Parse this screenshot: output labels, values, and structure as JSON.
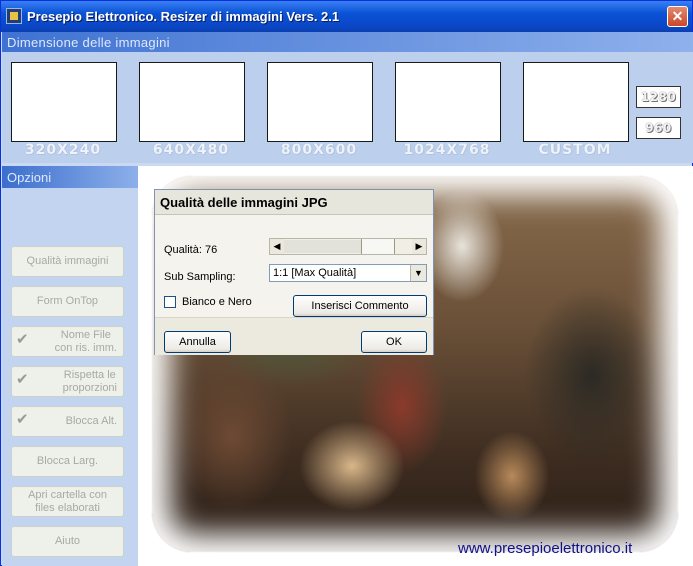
{
  "window": {
    "title": "Presepio Elettronico. Resizer di immagini  Vers. 2.1",
    "close_glyph": "✕"
  },
  "sizes": {
    "header": "Dimensione delle immagini",
    "presets": [
      {
        "label": "320X240"
      },
      {
        "label": "640X480"
      },
      {
        "label": "800X600"
      },
      {
        "label": "1024X768"
      },
      {
        "label": "CUSTOM"
      }
    ],
    "custom_width": "1280",
    "custom_height": "960"
  },
  "options": {
    "header": "Opzioni",
    "buttons": [
      {
        "label": "Qualità immagini",
        "checked": false
      },
      {
        "label": "Form OnTop",
        "checked": false
      },
      {
        "label": "Nome File\ncon ris. imm.",
        "checked": true
      },
      {
        "label": "Rispetta le\nproporzioni",
        "checked": true
      },
      {
        "label": "Blocca Alt.",
        "checked": true
      },
      {
        "label": "Blocca Larg.",
        "checked": false
      },
      {
        "label": "Apri cartella con\nfiles elaborati",
        "checked": false
      },
      {
        "label": "Aiuto",
        "checked": false
      }
    ]
  },
  "preview": {
    "watermark": "www.presepioelettronico.it"
  },
  "dialog": {
    "title": "Qualità delle immagini JPG",
    "quality_label": "Qualità: 76",
    "quality_value": 76,
    "subsampling_label": "Sub Sampling:",
    "subsampling_value": "1:1  [Max Qualità]",
    "bw_label": "Bianco e Nero",
    "bw_checked": false,
    "comment_button": "Inserisci Commento",
    "cancel_button": "Annulla",
    "ok_button": "OK"
  }
}
